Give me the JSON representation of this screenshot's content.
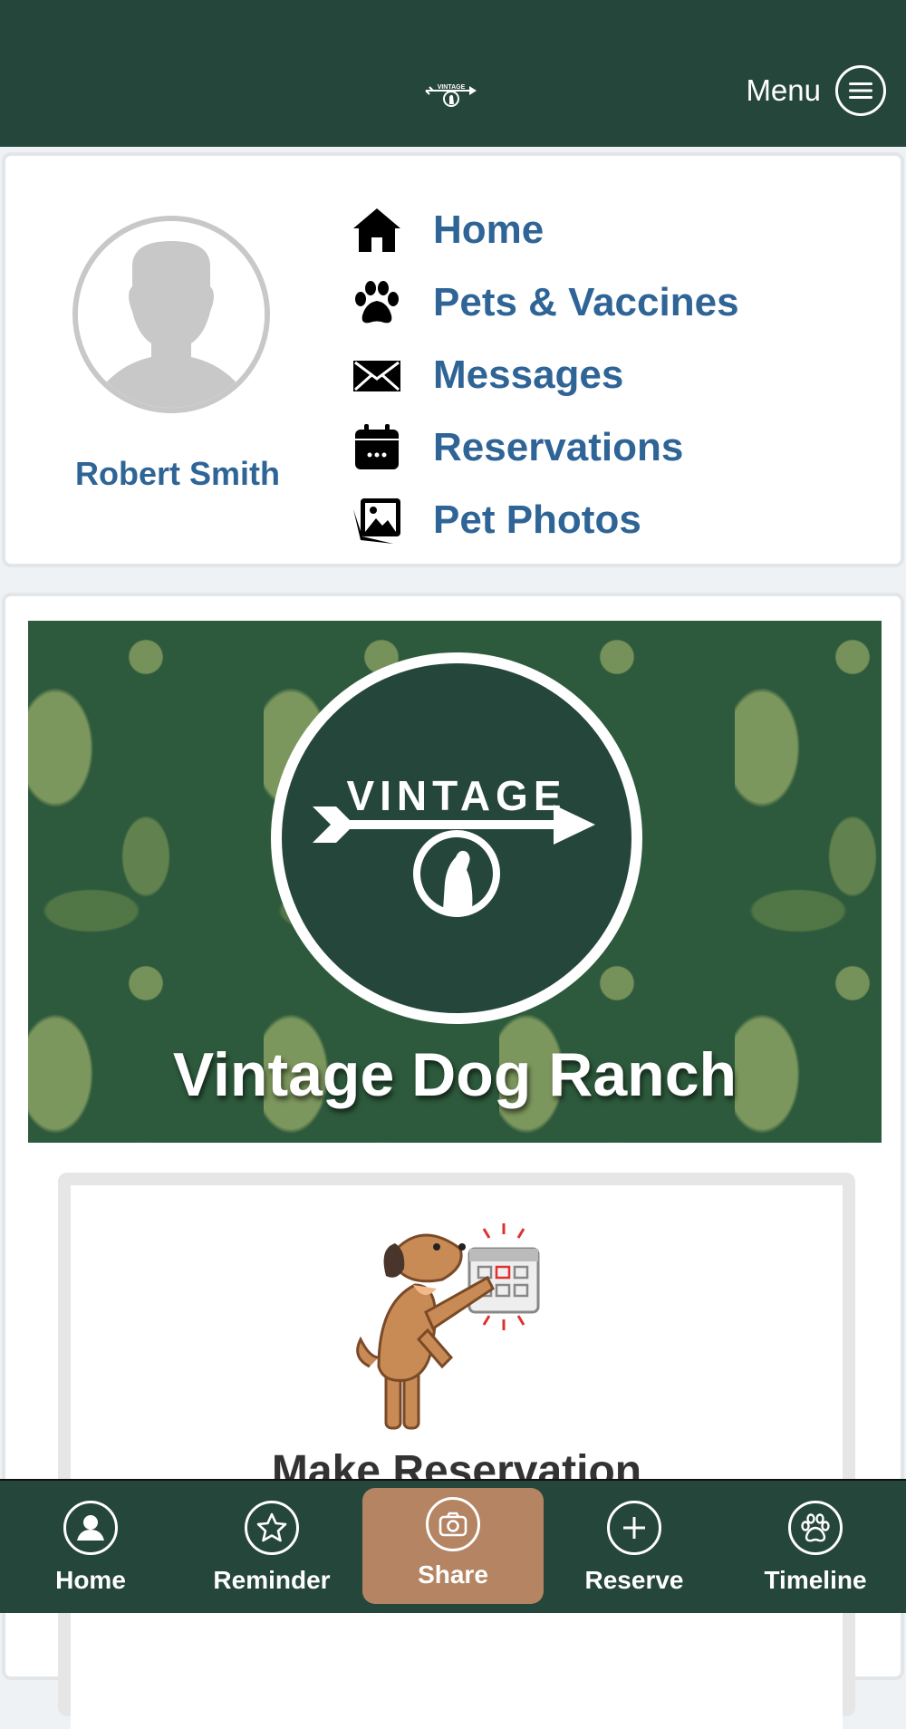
{
  "header": {
    "menu_label": "Menu",
    "logo_text": "VINTAGE",
    "colors": {
      "bar": "#25463b",
      "accent": "#2f6497"
    }
  },
  "profile": {
    "user_name": "Robert Smith",
    "nav_items": [
      {
        "label": "Home",
        "icon": "home-icon"
      },
      {
        "label": "Pets & Vaccines",
        "icon": "paw-icon"
      },
      {
        "label": "Messages",
        "icon": "envelope-icon"
      },
      {
        "label": "Reservations",
        "icon": "calendar-icon"
      },
      {
        "label": "Pet Photos",
        "icon": "photos-icon"
      }
    ]
  },
  "banner": {
    "logo_text": "VINTAGE",
    "title": "Vintage Dog Ranch"
  },
  "reservation_card": {
    "title": "Make Reservation"
  },
  "bottom_nav": {
    "items": [
      {
        "label": "Home",
        "icon": "user-icon"
      },
      {
        "label": "Reminder",
        "icon": "star-icon"
      },
      {
        "label": "Share",
        "icon": "camera-icon",
        "active": true,
        "active_color": "#b48463"
      },
      {
        "label": "Reserve",
        "icon": "plus-icon"
      },
      {
        "label": "Timeline",
        "icon": "paw-icon"
      }
    ]
  }
}
